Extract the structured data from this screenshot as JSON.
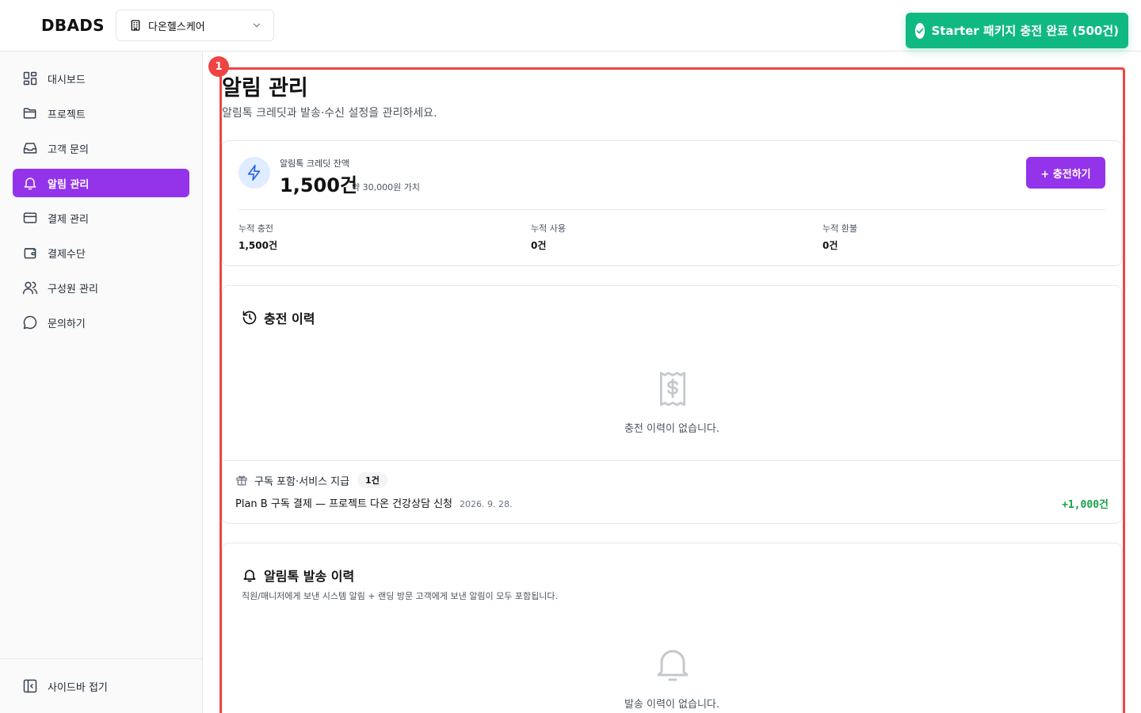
{
  "header": {
    "logo": "DBADS",
    "org_name": "다온헬스케어",
    "toast_message": "Starter 패키지 충전 완료 (500건)"
  },
  "sidebar": {
    "items": [
      {
        "label": "대시보드",
        "icon": "dashboard-icon"
      },
      {
        "label": "프로젝트",
        "icon": "folder-icon"
      },
      {
        "label": "고객 문의",
        "icon": "inbox-icon"
      },
      {
        "label": "알림 관리",
        "icon": "bell-icon",
        "active": true
      },
      {
        "label": "결제 관리",
        "icon": "credit-card-icon"
      },
      {
        "label": "결제수단",
        "icon": "wallet-icon"
      },
      {
        "label": "구성원 관리",
        "icon": "users-icon"
      },
      {
        "label": "문의하기",
        "icon": "chat-icon"
      }
    ],
    "collapse_label": "사이드바 접기"
  },
  "main": {
    "highlight_badge": "1",
    "title": "알림 관리",
    "subtitle": "알림톡 크레딧과 발송·수신 설정을 관리하세요.",
    "credit": {
      "label": "알림톡 크레딧 잔액",
      "amount": "1,500건",
      "value_note": "약 30,000원 가치",
      "charge_button": "+ 충전하기",
      "stats": [
        {
          "label": "누적 충전",
          "value": "1,500건"
        },
        {
          "label": "누적 사용",
          "value": "0건"
        },
        {
          "label": "누적 환불",
          "value": "0건"
        }
      ]
    },
    "charge_history": {
      "title": "충전 이력",
      "empty_text": "충전 이력이 없습니다.",
      "subscription_label": "구독 포함·서비스 지급",
      "subscription_count": "1건",
      "row_description": "Plan B 구독 결제 — 프로젝트 다온 건강상담 신청",
      "row_date": "2026. 9. 28.",
      "row_amount": "+1,000건"
    },
    "send_history": {
      "title": "알림톡 발송 이력",
      "description": "직원/매니저에게 보낸 시스템 알림 + 랜딩 방문 고객에게 보낸 알림이 모두 포함됩니다.",
      "empty_text": "발송 이력이 없습니다."
    }
  },
  "colors": {
    "accent": "#9333ea",
    "toast": "#10b981",
    "highlight": "#ef4444",
    "positive": "#16a34a"
  }
}
